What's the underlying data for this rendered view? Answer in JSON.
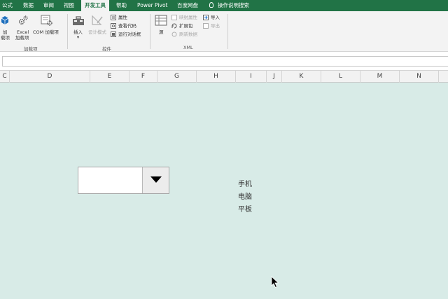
{
  "tabs": [
    {
      "label": "公式"
    },
    {
      "label": "数据"
    },
    {
      "label": "审阅"
    },
    {
      "label": "视图"
    },
    {
      "label": "开发工具",
      "active": true
    },
    {
      "label": "帮助"
    },
    {
      "label": "Power Pivot"
    },
    {
      "label": "百度网盘"
    },
    {
      "label": "操作说明搜索"
    }
  ],
  "ribbon": {
    "addins": {
      "addin_line1": "加",
      "addin_line2": "载项",
      "excel_line1": "Excel",
      "excel_line2": "加载项",
      "com_label": "COM 加载项",
      "group_label": "加载项"
    },
    "controls": {
      "insert_label": "插入",
      "design_mode_label": "设计模式",
      "properties_label": "属性",
      "view_code_label": "查看代码",
      "run_dialog_label": "运行对话框",
      "group_label": "控件"
    },
    "xml": {
      "source_label": "源",
      "map_props_label": "映射属性",
      "expansion_label": "扩展包",
      "refresh_label": "刷新数据",
      "import_label": "导入",
      "export_label": "导出",
      "group_label": "XML"
    }
  },
  "formula_bar": {
    "value": ""
  },
  "columns": [
    "C",
    "D",
    "E",
    "F",
    "G",
    "H",
    "I",
    "J",
    "K",
    "L",
    "M",
    "N"
  ],
  "combo_box": {
    "value": ""
  },
  "cells": {
    "item1": "手机",
    "item2": "电脑",
    "item3": "平板"
  },
  "colors": {
    "ribbon_tab_bar": "#217346",
    "sheet_background": "#d8ebe7"
  }
}
